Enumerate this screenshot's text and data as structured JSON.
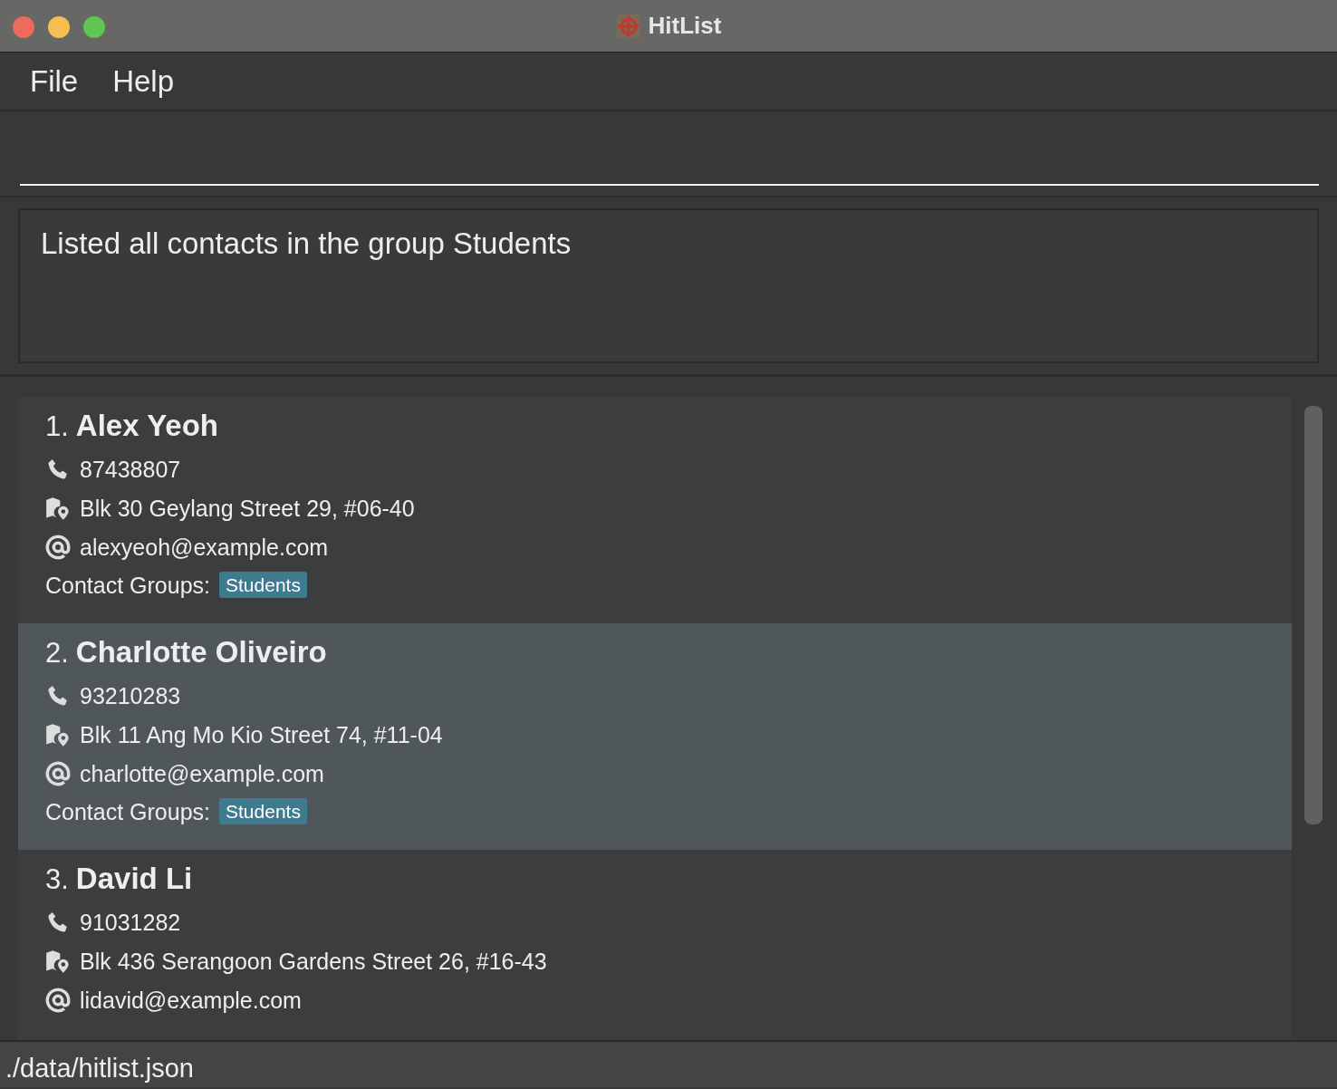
{
  "window": {
    "title": "HitList"
  },
  "menu": [
    {
      "label": "File"
    },
    {
      "label": "Help"
    }
  ],
  "result": {
    "text": "Listed all contacts in the group Students"
  },
  "contacts": [
    {
      "index": "1.",
      "name": "Alex Yeoh",
      "phone": "87438807",
      "address": "Blk 30 Geylang Street 29, #06-40",
      "email": "alexyeoh@example.com",
      "groups_label": "Contact Groups:",
      "groups": [
        "Students"
      ],
      "selected": false
    },
    {
      "index": "2.",
      "name": "Charlotte Oliveiro",
      "phone": "93210283",
      "address": "Blk 11 Ang Mo Kio Street 74, #11-04",
      "email": "charlotte@example.com",
      "groups_label": "Contact Groups:",
      "groups": [
        "Students"
      ],
      "selected": true
    },
    {
      "index": "3.",
      "name": "David Li",
      "phone": "91031282",
      "address": "Blk 436 Serangoon Gardens Street 26, #16-43",
      "email": "lidavid@example.com",
      "selected": false
    }
  ],
  "status_bar": {
    "path": "./data/hitlist.json"
  }
}
